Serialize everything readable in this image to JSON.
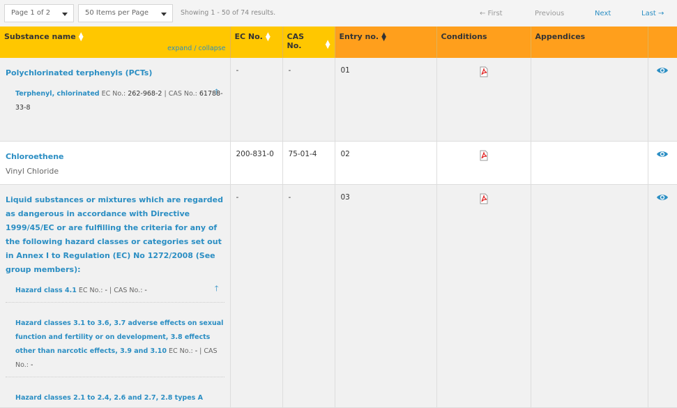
{
  "toolbar": {
    "page_select": "Page 1 of 2",
    "items_select": "50 Items per Page",
    "results": "Showing 1 - 50 of 74 results.",
    "first": "← First",
    "previous": "Previous",
    "next": "Next",
    "last": "Last →"
  },
  "table": {
    "headers": {
      "substance": "Substance name",
      "expand_collapse": "expand / collapse",
      "ec": "EC No.",
      "cas": "CAS No.",
      "entry": "Entry no.",
      "conditions": "Conditions",
      "appendices": "Appendices"
    },
    "rows": [
      {
        "name": "Polychlorinated terphenyls (PCTs)",
        "ec": "-",
        "cas": "-",
        "entry": "01",
        "member": {
          "name": "Terphenyl, chlorinated",
          "ec_label": "EC No.:",
          "ec": "262-968-2",
          "cas_label": "| CAS No.:",
          "cas": "61788-33-8"
        }
      },
      {
        "name": "Chloroethene",
        "subtitle": "Vinyl Chloride",
        "ec": "200-831-0",
        "cas": "75-01-4",
        "entry": "02"
      },
      {
        "name": "Liquid substances or mixtures which are regarded as dangerous in accordance with Directive 1999/45/EC or are fulfilling the criteria for any of the following hazard classes or categories set out in Annex I to Regulation (EC) No 1272/2008 (See group members):",
        "ec": "-",
        "cas": "-",
        "entry": "03",
        "members": [
          {
            "name": "Hazard class 4.1",
            "ec_label": "EC No.:",
            "ec": "-",
            "cas_label": "| CAS No.:",
            "cas": "-"
          },
          {
            "name": "Hazard classes 3.1 to 3.6, 3.7 adverse effects on sexual function and fertility or on development, 3.8 effects other than narcotic effects, 3.9 and 3.10",
            "ec_label": "EC No.:",
            "ec": "-",
            "cas_label": "| CAS No.:",
            "cas": "-"
          },
          {
            "name": "Hazard classes 2.1 to 2.4, 2.6 and 2.7, 2.8 types A"
          }
        ]
      }
    ]
  },
  "colors": {
    "header_yellow": "#ffc700",
    "header_orange": "#ff9f1c",
    "link_blue": "#2b8ec3"
  },
  "icons": {
    "sort": "sort-icon",
    "pdf": "pdf-icon",
    "eye": "eye-icon",
    "up": "arrow-up-icon"
  }
}
